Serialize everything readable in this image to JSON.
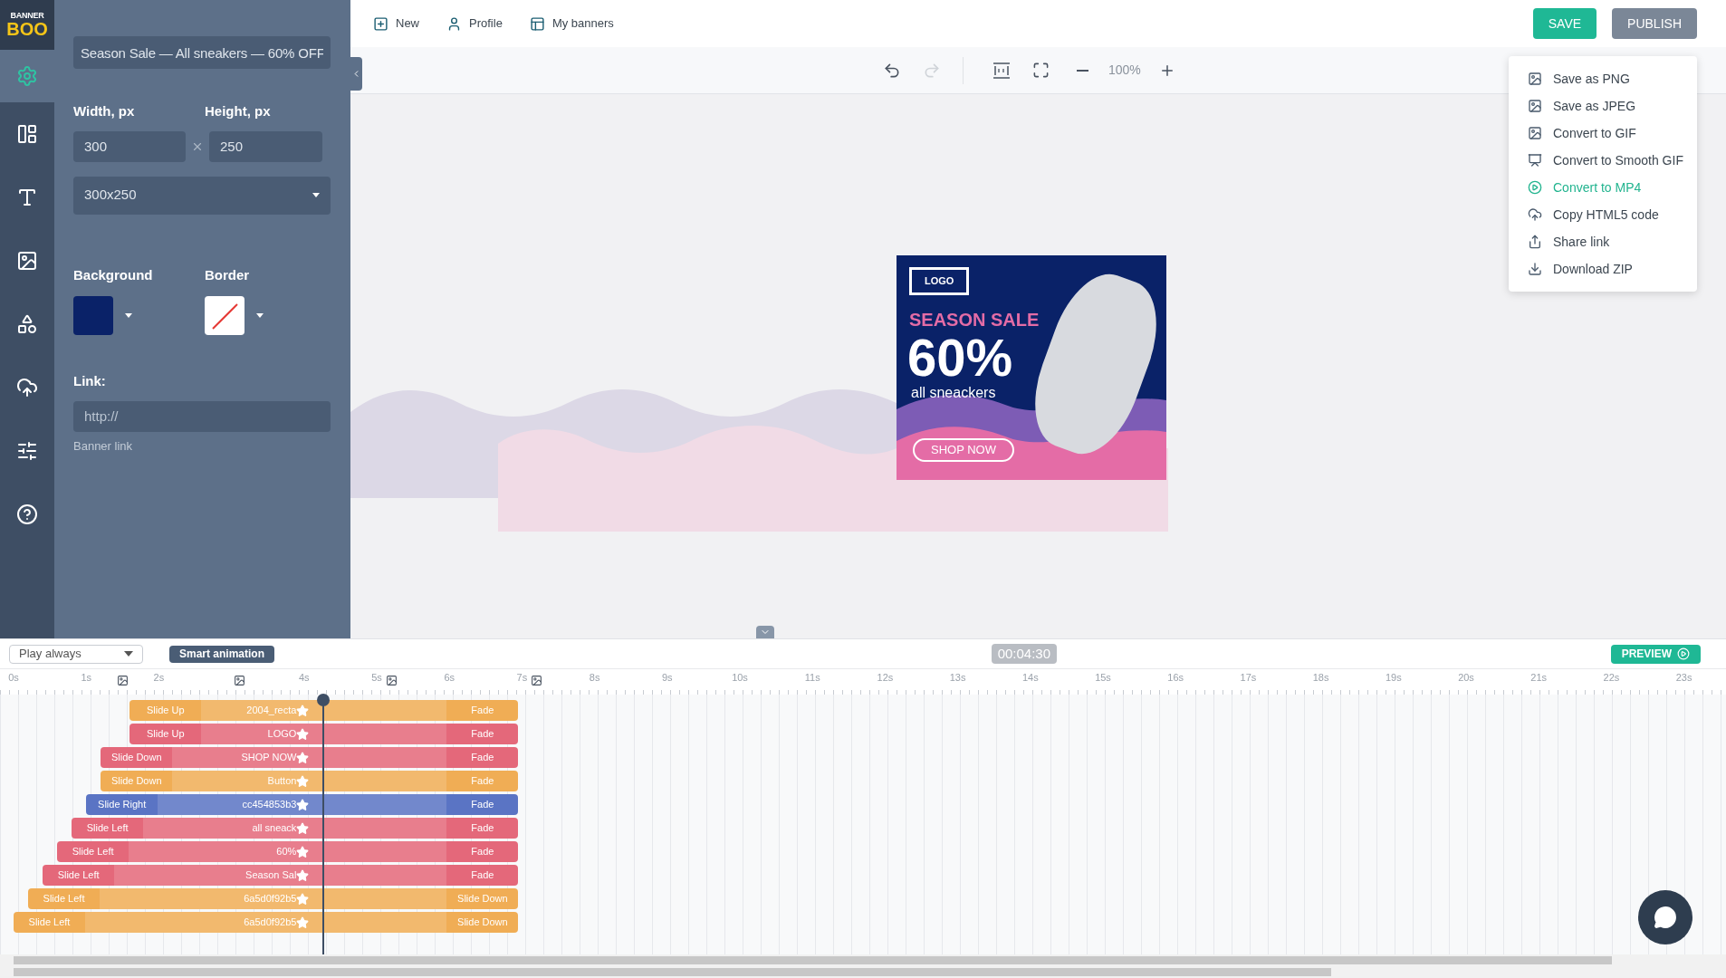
{
  "logo": {
    "line1": "BANNER",
    "line2": "BOO"
  },
  "rail": [
    {
      "kind": "settings",
      "selected": true
    },
    {
      "kind": "layout",
      "selected": false
    },
    {
      "kind": "text",
      "selected": false
    },
    {
      "kind": "image",
      "selected": false
    },
    {
      "kind": "shapes",
      "selected": false
    },
    {
      "kind": "upload",
      "selected": false
    },
    {
      "kind": "sliders",
      "selected": false
    },
    {
      "kind": "help",
      "selected": false
    }
  ],
  "settings": {
    "title_value": "Season Sale — All sneakers — 60% OFF",
    "width_label": "Width, px",
    "width_value": "300",
    "height_label": "Height, px",
    "height_value": "250",
    "size_preset": "300x250",
    "background_label": "Background",
    "border_label": "Border",
    "link_label": "Link:",
    "link_placeholder": "http://",
    "link_hint": "Banner link"
  },
  "topnav": [
    {
      "kind": "new",
      "label": "New"
    },
    {
      "kind": "profile",
      "label": "Profile"
    },
    {
      "kind": "banners",
      "label": "My banners"
    }
  ],
  "actions": {
    "save": "SAVE",
    "publish": "PUBLISH"
  },
  "toolbar": {
    "undo_disabled": false,
    "redo_disabled": true,
    "zoom": "100%"
  },
  "export_menu": [
    {
      "kind": "image",
      "label": "Save as PNG",
      "highlighted": false
    },
    {
      "kind": "image",
      "label": "Save as JPEG",
      "highlighted": false
    },
    {
      "kind": "image",
      "label": "Convert to GIF",
      "highlighted": false
    },
    {
      "kind": "presentation",
      "label": "Convert to Smooth GIF",
      "highlighted": false
    },
    {
      "kind": "play",
      "label": "Convert to MP4",
      "highlighted": true
    },
    {
      "kind": "cloud",
      "label": "Copy HTML5 code",
      "highlighted": false
    },
    {
      "kind": "share",
      "label": "Share link",
      "highlighted": false
    },
    {
      "kind": "download",
      "label": "Download ZIP",
      "highlighted": false
    }
  ],
  "banner": {
    "logo": "LOGO",
    "headline": "SEASON SALE",
    "discount": "60%",
    "subline": "all sneackers",
    "cta": "SHOP NOW"
  },
  "timeline": {
    "play_mode": "Play always",
    "smart_animation": "Smart animation",
    "time": "00:04:30",
    "preview": "PREVIEW",
    "ticks": [
      "0s",
      "1s",
      "2s",
      "4s",
      "5s",
      "6s",
      "7s",
      "8s",
      "9s",
      "10s",
      "11s",
      "12s",
      "13s",
      "14s",
      "15s",
      "16s",
      "17s",
      "18s",
      "19s",
      "20s",
      "21s",
      "22s",
      "23s"
    ],
    "tracks": [
      {
        "in": "Slide Up",
        "name": "2004_recta",
        "out": "Fade",
        "color": "#f0ad55"
      },
      {
        "in": "Slide Up",
        "name": "LOGO",
        "out": "Fade",
        "color": "#e4687a"
      },
      {
        "in": "Slide Down",
        "name": "SHOP NOW",
        "out": "Fade",
        "color": "#e4687a"
      },
      {
        "in": "Slide Down",
        "name": "Button",
        "out": "Fade",
        "color": "#f0ad55"
      },
      {
        "in": "Slide Right",
        "name": "cc454853b3",
        "out": "Fade",
        "color": "#5a74c4"
      },
      {
        "in": "Slide Left",
        "name": "all sneack",
        "out": "Fade",
        "color": "#e4687a"
      },
      {
        "in": "Slide Left",
        "name": "60%",
        "out": "Fade",
        "color": "#e4687a"
      },
      {
        "in": "Slide Left",
        "name": "Season Sal",
        "out": "Fade",
        "color": "#e4687a"
      },
      {
        "in": "Slide Left",
        "name": "6a5d0f92b5",
        "out": "Slide Down",
        "color": "#f0ad55"
      },
      {
        "in": "Slide Left",
        "name": "6a5d0f92b5",
        "out": "Slide Down",
        "color": "#f0ad55"
      }
    ]
  }
}
